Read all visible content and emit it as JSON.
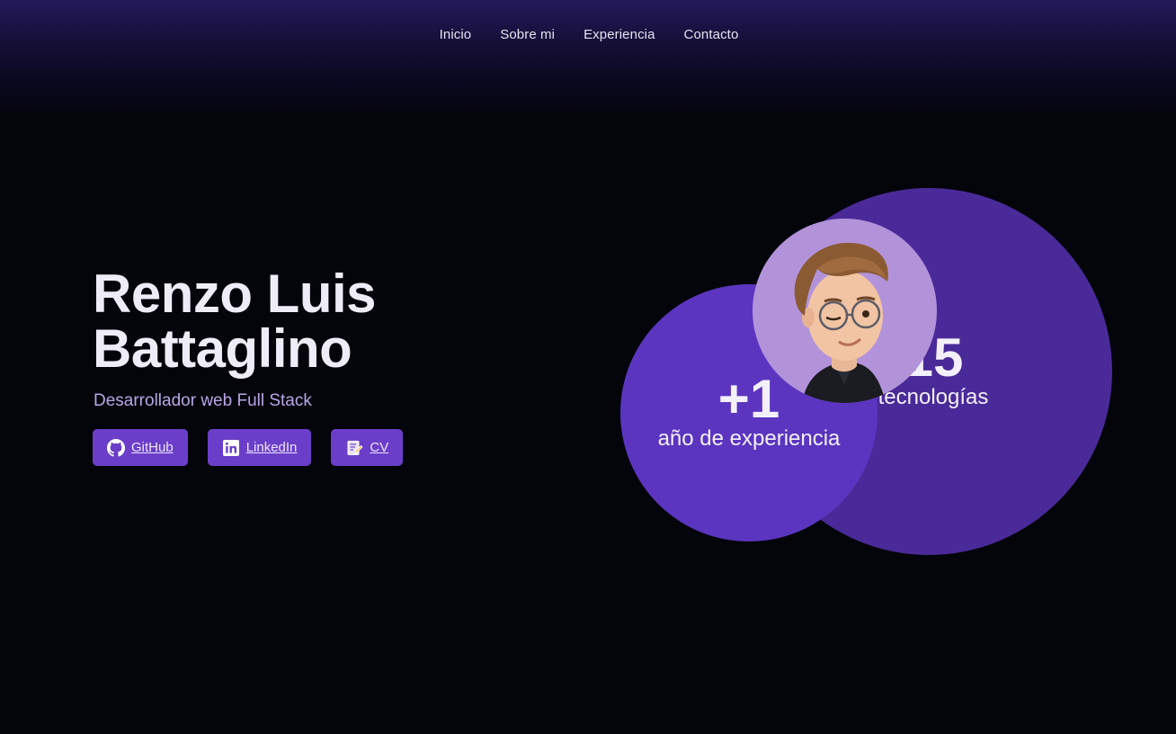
{
  "nav": {
    "items": [
      "Inicio",
      "Sobre mi",
      "Experiencia",
      "Contacto"
    ]
  },
  "hero": {
    "name_line1": "Renzo Luis",
    "name_line2": "Battaglino",
    "subtitle": "Desarrollador web Full Stack",
    "buttons": [
      {
        "label": "GitHub",
        "icon": "github-icon"
      },
      {
        "label": "LinkedIn",
        "icon": "linkedin-icon"
      },
      {
        "label": "CV",
        "icon": "document-edit-icon"
      }
    ]
  },
  "stats": {
    "technologies": {
      "value": "15",
      "label": "tecnologías"
    },
    "experience": {
      "value": "+1",
      "label": "año de experiencia"
    }
  },
  "colors": {
    "background": "#04040b",
    "accent": "#6b3ec9",
    "circle_large": "#4a2a98",
    "circle_small": "#5b35c0",
    "avatar_bg": "#b293da",
    "subtitle": "#b9a6e6"
  }
}
